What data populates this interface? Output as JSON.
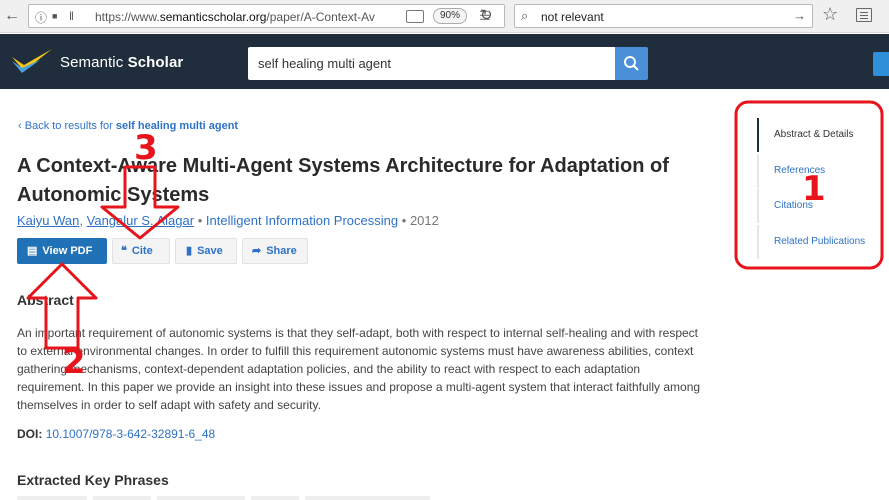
{
  "browser": {
    "url_prefix": "https://www.",
    "url_domain": "semanticscholar.org",
    "url_path": "/paper/A-Context-Av",
    "zoom": "90%",
    "search_value": "not relevant"
  },
  "header": {
    "logo_text_light": "Semantic",
    "logo_text_bold": "Scholar",
    "search_value": "self healing multi agent"
  },
  "main": {
    "back_prefix": "Back to results for",
    "back_query": "self healing multi agent",
    "title": "A Context-Aware Multi-Agent Systems Architecture for Adaptation of Autonomic Systems",
    "authors": [
      "Kaiyu Wan",
      "Vangalur S. Alagar"
    ],
    "author_sep": ",",
    "meta_sep": "•",
    "venue": "Intelligent Information Processing",
    "year": "2012",
    "buttons": {
      "view_pdf": "View PDF",
      "cite": "Cite",
      "save": "Save",
      "share": "Share"
    },
    "abstract_heading": "Abstract",
    "abstract": "An important requirement of autonomic systems is that they self-adapt, both with respect to internal self-healing and with respect to external environmental changes. In order to fulfill this requirement autonomic systems must have awareness abilities, context gathering mechanisms, context-dependent adaptation policies, and the ability to react with respect to each adaptation requirement. In this paper we provide an insight into these issues and propose a multi-agent system that interact faithfully among themselves in order to self adapt with safety and security.",
    "doi_label": "DOI:",
    "doi_value": "10.1007/978-3-642-32891-6_48",
    "key_phrases_heading": "Extracted Key Phrases"
  },
  "side_nav": {
    "items": [
      "Abstract & Details",
      "References",
      "Citations",
      "Related Publications"
    ],
    "active_index": 0
  },
  "annotations": {
    "labels": [
      "1",
      "2",
      "3"
    ],
    "color": "#e8141c"
  },
  "icons": [
    "back-arrow-icon",
    "forward-arrow-icon",
    "info-icon",
    "lock-icon",
    "reader-view-icon",
    "bookmark-url-icon",
    "reload-icon",
    "search-icon",
    "go-arrow-icon",
    "star-icon",
    "library-icon",
    "logo-icon",
    "pdf-icon",
    "quote-icon",
    "bookmark-icon",
    "share-icon",
    "chevron-left-icon"
  ],
  "colors": {
    "header_bg": "#1f2d3c",
    "link": "#2e72c7",
    "primary_button": "#2071b5",
    "search_button": "#4a90d9"
  }
}
